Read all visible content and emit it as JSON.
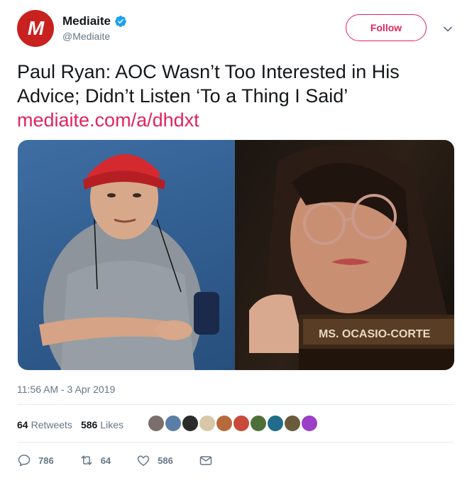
{
  "account": {
    "display_name": "Mediaite",
    "handle": "@Mediaite",
    "avatar_letter": "M",
    "avatar_color": "#c8211f",
    "verified": true
  },
  "follow_label": "Follow",
  "tweet": {
    "text": "Paul Ryan: AOC Wasn’t Too Interested in His Advice; Didn’t Listen ‘To a Thing I Said’",
    "link": "mediaite.com/a/dhdxt",
    "link_color": "#e0245e",
    "nameplate": "MS. OCASIO-CORTE"
  },
  "timestamp": "11:56 AM - 3 Apr 2019",
  "stats": {
    "retweets_count": "64",
    "retweets_label": "Retweets",
    "likes_count": "586",
    "likes_label": "Likes"
  },
  "actions": {
    "reply_count": "786",
    "retweet_count": "64",
    "like_count": "586"
  }
}
